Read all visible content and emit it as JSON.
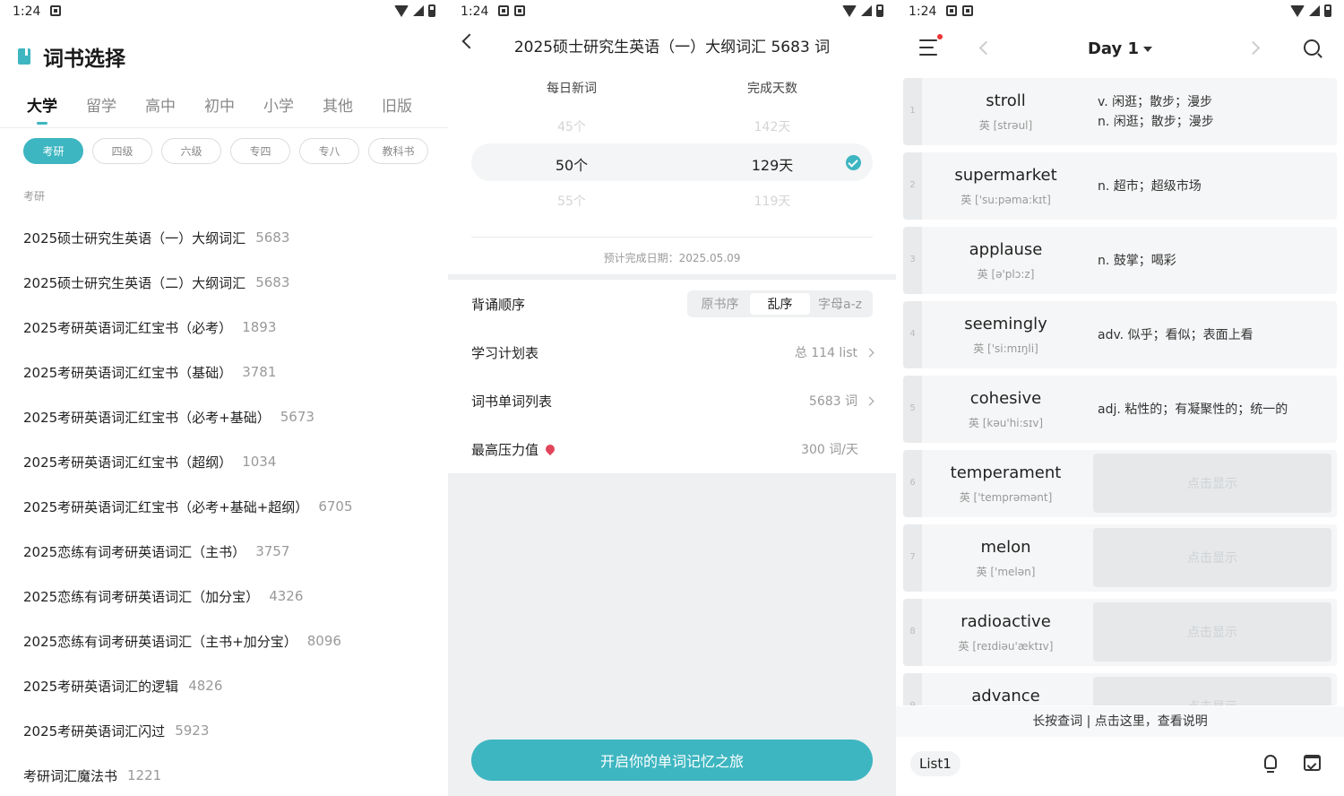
{
  "status": {
    "time": "1:24"
  },
  "panel1": {
    "title": "词书选择",
    "tabs": [
      "大学",
      "留学",
      "高中",
      "初中",
      "小学",
      "其他",
      "旧版"
    ],
    "chips": [
      "考研",
      "四级",
      "六级",
      "专四",
      "专八",
      "教科书"
    ],
    "section_label": "考研",
    "books": [
      {
        "name": "2025硕士研究生英语（一）大纲词汇",
        "count": "5683"
      },
      {
        "name": "2025硕士研究生英语（二）大纲词汇",
        "count": "5683"
      },
      {
        "name": "2025考研英语词汇红宝书（必考）",
        "count": "1893"
      },
      {
        "name": "2025考研英语词汇红宝书（基础）",
        "count": "3781"
      },
      {
        "name": "2025考研英语词汇红宝书（必考+基础）",
        "count": "5673"
      },
      {
        "name": "2025考研英语词汇红宝书（超纲）",
        "count": "1034"
      },
      {
        "name": "2025考研英语词汇红宝书（必考+基础+超纲）",
        "count": "6705"
      },
      {
        "name": "2025恋练有词考研英语词汇（主书）",
        "count": "3757"
      },
      {
        "name": "2025恋练有词考研英语词汇（加分宝）",
        "count": "4326"
      },
      {
        "name": "2025恋练有词考研英语词汇（主书+加分宝）",
        "count": "8096"
      },
      {
        "name": "2025考研英语词汇的逻辑",
        "count": "4826"
      },
      {
        "name": "2025考研英语词汇闪过",
        "count": "5923"
      },
      {
        "name": "考研词汇魔法书",
        "count": "1221"
      }
    ]
  },
  "panel2": {
    "title": "2025硕士研究生英语（一）大纲词汇 5683 词",
    "picker": {
      "col1_header": "每日新词",
      "col2_header": "完成天数",
      "above": [
        "45个",
        "142天"
      ],
      "selected": [
        "50个",
        "129天"
      ],
      "below": [
        "55个",
        "119天"
      ]
    },
    "completion_date": "预计完成日期：2025.05.09",
    "order_label": "背诵顺序",
    "order_options": [
      "原书序",
      "乱序",
      "字母a-z"
    ],
    "plan_label": "学习计划表",
    "plan_value": "总 114 list",
    "wordlist_label": "词书单词列表",
    "wordlist_value": "5683 词",
    "pressure_label": "最高压力值",
    "pressure_value": "300 词/天",
    "start_button": "开启你的单词记忆之旅"
  },
  "panel3": {
    "day_title": "Day 1",
    "words": [
      {
        "idx": "1",
        "word": "stroll",
        "phon": "英 [strəul]",
        "def": [
          "v. 闲逛；散步；漫步",
          "n. 闲逛；散步；漫步"
        ]
      },
      {
        "idx": "2",
        "word": "supermarket",
        "phon": "英 ['su:pəma:kɪt]",
        "def": [
          "n. 超市；超级市场"
        ]
      },
      {
        "idx": "3",
        "word": "applause",
        "phon": "英 [ə'plɔ:z]",
        "def": [
          "n. 鼓掌；喝彩"
        ]
      },
      {
        "idx": "4",
        "word": "seemingly",
        "phon": "英 ['si:mɪŋli]",
        "def": [
          "adv. 似乎；看似；表面上看"
        ]
      },
      {
        "idx": "5",
        "word": "cohesive",
        "phon": "英 [kəu'hi:sɪv]",
        "def": [
          "adj. 粘性的；有凝聚性的；统一的"
        ]
      },
      {
        "idx": "6",
        "word": "temperament",
        "phon": "英 ['temprəmənt]",
        "hidden": "点击显示"
      },
      {
        "idx": "7",
        "word": "melon",
        "phon": "英 ['melən]",
        "hidden": "点击显示"
      },
      {
        "idx": "8",
        "word": "radioactive",
        "phon": "英 [reɪdiəu'æktɪv]",
        "hidden": "点击显示"
      },
      {
        "idx": "9",
        "word": "advance",
        "phon": "",
        "hidden": "点击显示"
      }
    ],
    "hint": "长按查词 | 点击这里，查看说明",
    "list_label": "List1"
  },
  "colors": {
    "accent": "#3db6c1",
    "pressure_icon": "#e0455a",
    "notify_dot": "#ee3333"
  },
  "icons": [
    "back-arrow-icon",
    "check-icon",
    "menu-icon",
    "search-icon",
    "bulb-icon",
    "calendar-check-icon",
    "book-icon",
    "drop-icon"
  ]
}
